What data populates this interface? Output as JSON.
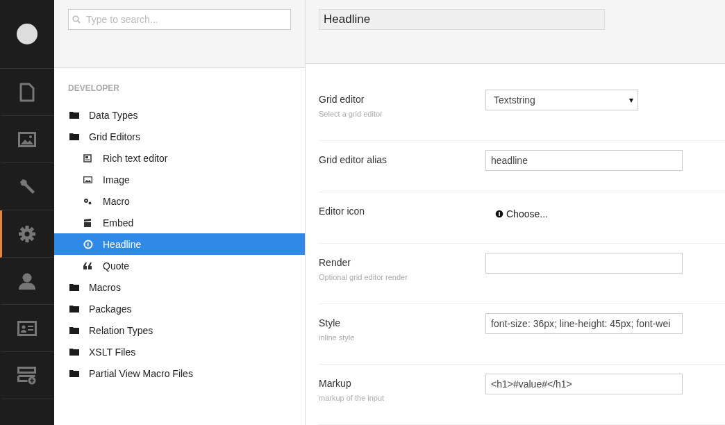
{
  "nav": [
    {
      "selected": false
    },
    {
      "selected": false
    },
    {
      "selected": false
    },
    {
      "selected": true
    },
    {
      "selected": false
    },
    {
      "selected": false
    },
    {
      "selected": false
    }
  ],
  "search": {
    "placeholder": "Type to search..."
  },
  "tree": {
    "title": "DEVELOPER",
    "items": [
      {
        "label": "Data Types",
        "selected": false
      },
      {
        "label": "Grid Editors",
        "selected": false,
        "children": [
          {
            "label": "Rich text editor",
            "selected": false
          },
          {
            "label": "Image",
            "selected": false
          },
          {
            "label": "Macro",
            "selected": false
          },
          {
            "label": "Embed",
            "selected": false
          },
          {
            "label": "Headline",
            "selected": true
          },
          {
            "label": "Quote",
            "selected": false
          }
        ]
      },
      {
        "label": "Macros",
        "selected": false
      },
      {
        "label": "Packages",
        "selected": false
      },
      {
        "label": "Relation Types",
        "selected": false
      },
      {
        "label": "XSLT Files",
        "selected": false
      },
      {
        "label": "Partial View Macro Files",
        "selected": false
      }
    ]
  },
  "editor": {
    "name": "Headline",
    "fields": [
      {
        "kind": "select",
        "label": "Grid editor",
        "description": "Select a grid editor",
        "value": "Textstring",
        "caret": "▾"
      },
      {
        "kind": "text",
        "label": "Grid editor alias",
        "value": "headline"
      },
      {
        "kind": "icon",
        "label": "Editor icon",
        "value": "Choose..."
      },
      {
        "kind": "text",
        "label": "Render",
        "description": "Optional grid editor render"
      },
      {
        "kind": "text",
        "label": "Style",
        "description": "inline style",
        "value": "font-size: 36px; line-height: 45px; font-wei"
      },
      {
        "kind": "text",
        "label": "Markup",
        "description": "markup of the input",
        "value": "<h1>#value#</h1>"
      }
    ]
  }
}
